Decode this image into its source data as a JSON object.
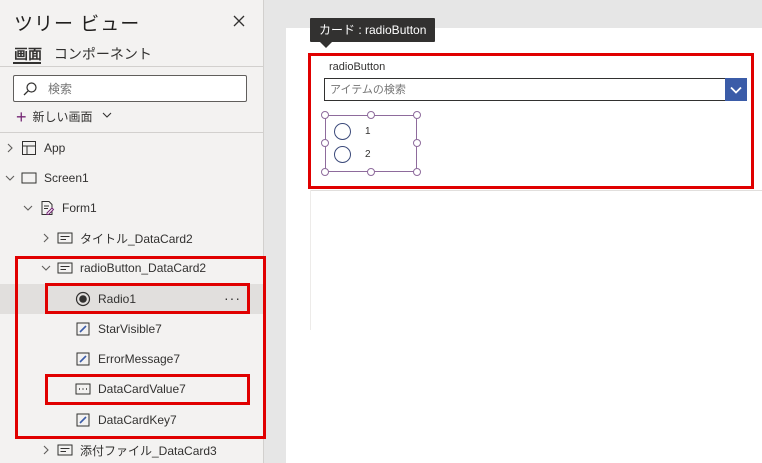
{
  "panel": {
    "title": "ツリー ビュー",
    "tabs": [
      "画面",
      "コンポーネント"
    ],
    "search_placeholder": "検索",
    "new_screen_label": "新しい画面",
    "tree": [
      {
        "label": "App",
        "icon": "app-icon"
      },
      {
        "label": "Screen1",
        "icon": "screen-icon"
      },
      {
        "label": "Form1",
        "icon": "form-icon"
      },
      {
        "label": "タイトル_DataCard2",
        "icon": "datacard-icon"
      },
      {
        "label": "radioButton_DataCard2",
        "icon": "datacard-icon"
      },
      {
        "label": "Radio1",
        "icon": "radio-icon",
        "more": "···"
      },
      {
        "label": "StarVisible7",
        "icon": "edit-label-icon"
      },
      {
        "label": "ErrorMessage7",
        "icon": "edit-label-icon"
      },
      {
        "label": "DataCardValue7",
        "icon": "combobox-icon"
      },
      {
        "label": "DataCardKey7",
        "icon": "edit-label-icon"
      },
      {
        "label": "添付ファイル_DataCard3",
        "icon": "datacard-icon"
      }
    ]
  },
  "canvas": {
    "tooltip": "カード : radioButton",
    "card_label": "radioButton",
    "combo_placeholder": "アイテムの検索",
    "radio_options": [
      "1",
      "2"
    ]
  },
  "colors": {
    "highlight": "#e00000",
    "accent": "#742774",
    "combo_button": "#3b5ca8",
    "selection_bg": "#e1dfdd"
  }
}
